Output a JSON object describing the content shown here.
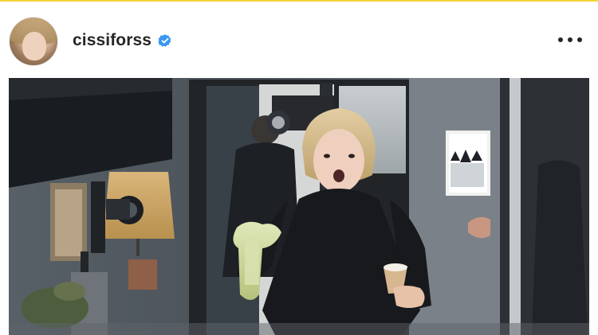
{
  "post": {
    "header": {
      "username": "cissiforss",
      "verified": true,
      "avatar_icon": "profile-avatar",
      "more_icon": "more-options-icon"
    },
    "media": {
      "type": "photo",
      "description_icon": "post-photo"
    }
  },
  "colors": {
    "top_accent": "#f2d23a",
    "verified_badge": "#3897f0",
    "text_primary": "#262626"
  }
}
